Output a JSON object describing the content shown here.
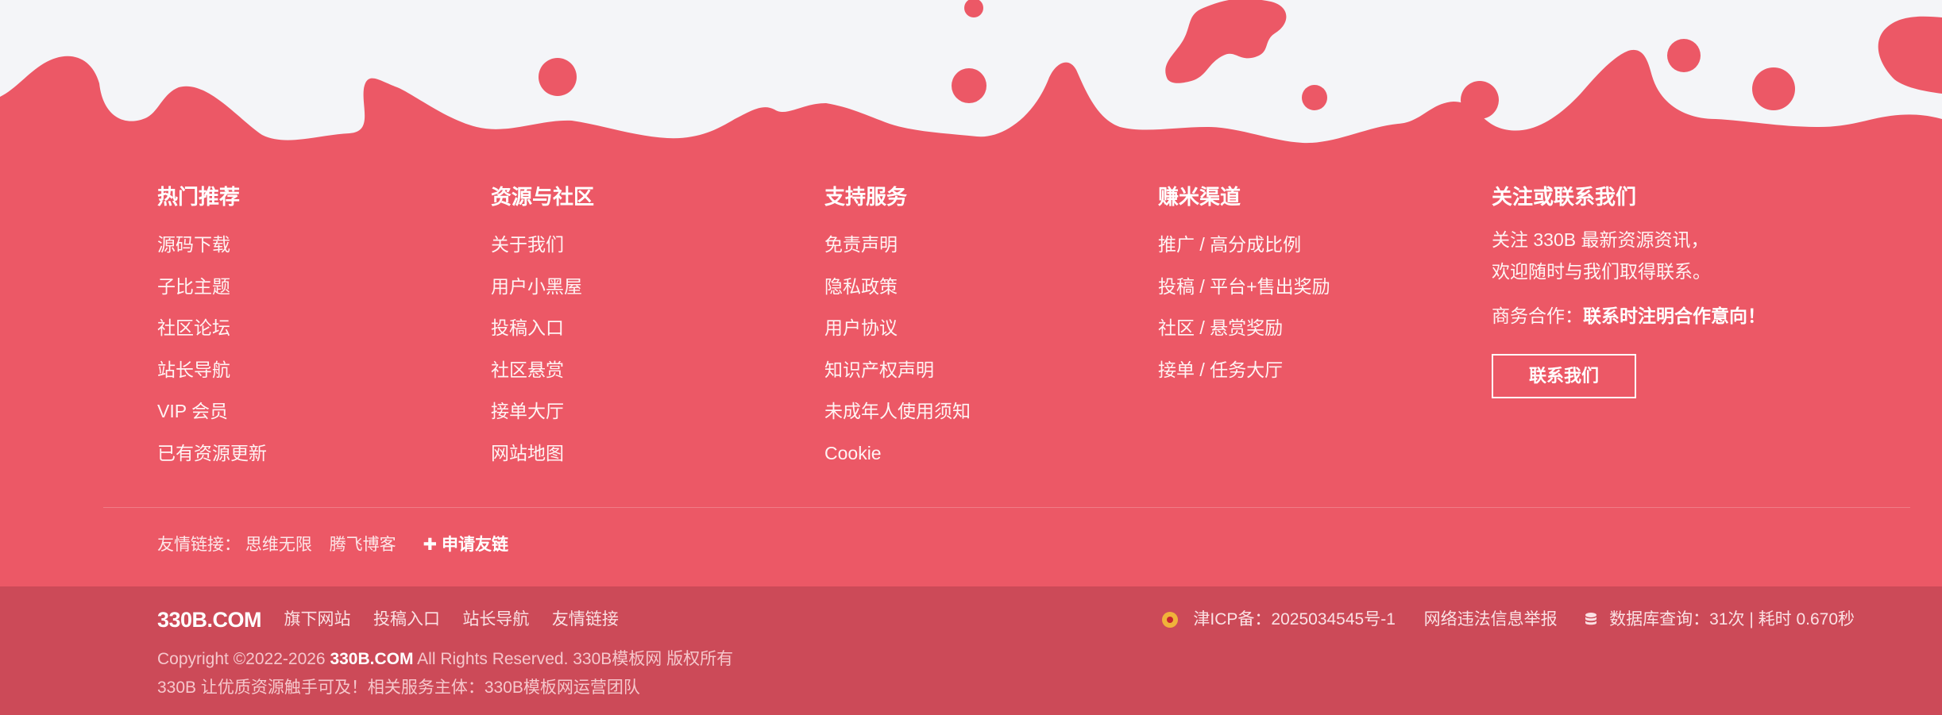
{
  "colors": {
    "background": "#f4f5f8",
    "footer": "#ec5866",
    "footer_bottom": "#cc4a58",
    "text": "#fff4f4"
  },
  "columns": [
    {
      "title": "热门推荐",
      "items": [
        "源码下载",
        "子比主题",
        "社区论坛",
        "站长导航",
        "VIP 会员",
        "已有资源更新"
      ]
    },
    {
      "title": "资源与社区",
      "items": [
        "关于我们",
        "用户小黑屋",
        "投稿入口",
        "社区悬赏",
        "接单大厅",
        "网站地图"
      ]
    },
    {
      "title": "支持服务",
      "items": [
        "免责声明",
        "隐私政策",
        "用户协议",
        "知识产权声明",
        "未成年人使用须知",
        "Cookie"
      ]
    },
    {
      "title": "赚米渠道",
      "items": [
        "推广 / 高分成比例",
        "投稿 / 平台+售出奖励",
        "社区 / 悬赏奖励",
        "接单 / 任务大厅"
      ]
    }
  ],
  "contact": {
    "title": "关注或联系我们",
    "line1": "关注 330B 最新资源资讯，",
    "line2": "欢迎随时与我们取得联系。",
    "biz_label": "商务合作：",
    "biz_value": "联系时注明合作意向！",
    "button": "联系我们"
  },
  "friend_links": {
    "label": "友情链接：",
    "items": [
      "思维无限",
      "腾飞博客"
    ],
    "apply": "申请友链",
    "apply_icon": "plus-icon"
  },
  "bottom": {
    "brand": "330B.COM",
    "nav": [
      "旗下网站",
      "投稿入口",
      "站长导航",
      "友情链接"
    ],
    "icp": "津ICP备：2025034545号-1",
    "report": "网络违法信息举报",
    "db_stats": "数据库查询：31次 | 耗时 0.670秒",
    "copy_prefix": "Copyright ©2022-2026 ",
    "copy_brand": "330B.COM",
    "copy_suffix": " All Rights Reserved. 330B模板网 版权所有",
    "tagline": "330B 让优质资源触手可及！相关服务主体：330B模板网运营团队"
  }
}
